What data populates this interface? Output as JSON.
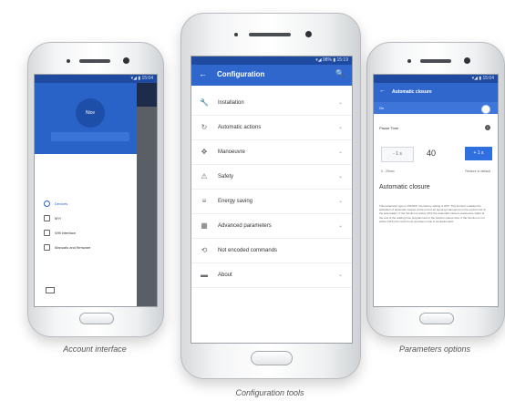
{
  "left_phone": {
    "status_text": "▾◢ ▮ 15:04",
    "avatar_text": "Nice",
    "menu_items": [
      {
        "label": "Devices",
        "icon": "home-icon"
      },
      {
        "label": "MY!",
        "icon": "list-icon"
      },
      {
        "label": "Wifi interface",
        "icon": "wifi-icon"
      },
      {
        "label": "Manuals and firmware",
        "icon": "book-icon"
      }
    ],
    "caption": "Account interface"
  },
  "center_phone": {
    "status_text": "▾◢ 98% ▮ 15:19",
    "back_glyph": "←",
    "title": "Configuration",
    "search_glyph": "🔍",
    "menu_items": [
      {
        "label": "Installation",
        "icon": "wrench-icon",
        "glyph": "🔧"
      },
      {
        "label": "Automatic actions",
        "icon": "refresh-icon",
        "glyph": "↻"
      },
      {
        "label": "Manoeuvre",
        "icon": "move-icon",
        "glyph": "✥"
      },
      {
        "label": "Safety",
        "icon": "safety-icon",
        "glyph": "⚠"
      },
      {
        "label": "Energy saving",
        "icon": "energy-icon",
        "glyph": "≡"
      },
      {
        "label": "Advanced parameters",
        "icon": "grid-icon",
        "glyph": "▦"
      },
      {
        "label": "Not encoded commands",
        "icon": "sync-icon",
        "glyph": "⟲"
      },
      {
        "label": "About",
        "icon": "folder-icon",
        "glyph": "▬"
      }
    ],
    "chevron": "⌄",
    "caption": "Configuration tools"
  },
  "right_phone": {
    "status_text": "▾◢ ▮ 15:04",
    "back_glyph": "←",
    "title": "Automatic closure",
    "toggle_label": "On",
    "pause_label": "Pause Time",
    "info_glyph": "i",
    "minus_label": "- 1 s",
    "value": "40",
    "plus_label": "+ 1 s",
    "small_left": "0 - 25min",
    "small_right": "Restore to default",
    "heading": "Automatic closure",
    "paragraph": "This parameter type is ON/OFF; the factory setting is OFF. This function enables the activation of automatic closure at the end of an opening manoeuvre in the control unit of the automation. If the function is active (ON) the automatic closure manoeuvre starts at the end of the waiting time programmed in the function pause time. If the function is not active (OFF) the control unit operates mode is semiautomatic.",
    "caption": "Parameters options"
  },
  "colors": {
    "primary_blue": "#2f67cd",
    "dark_status": "#1e4aa0"
  }
}
